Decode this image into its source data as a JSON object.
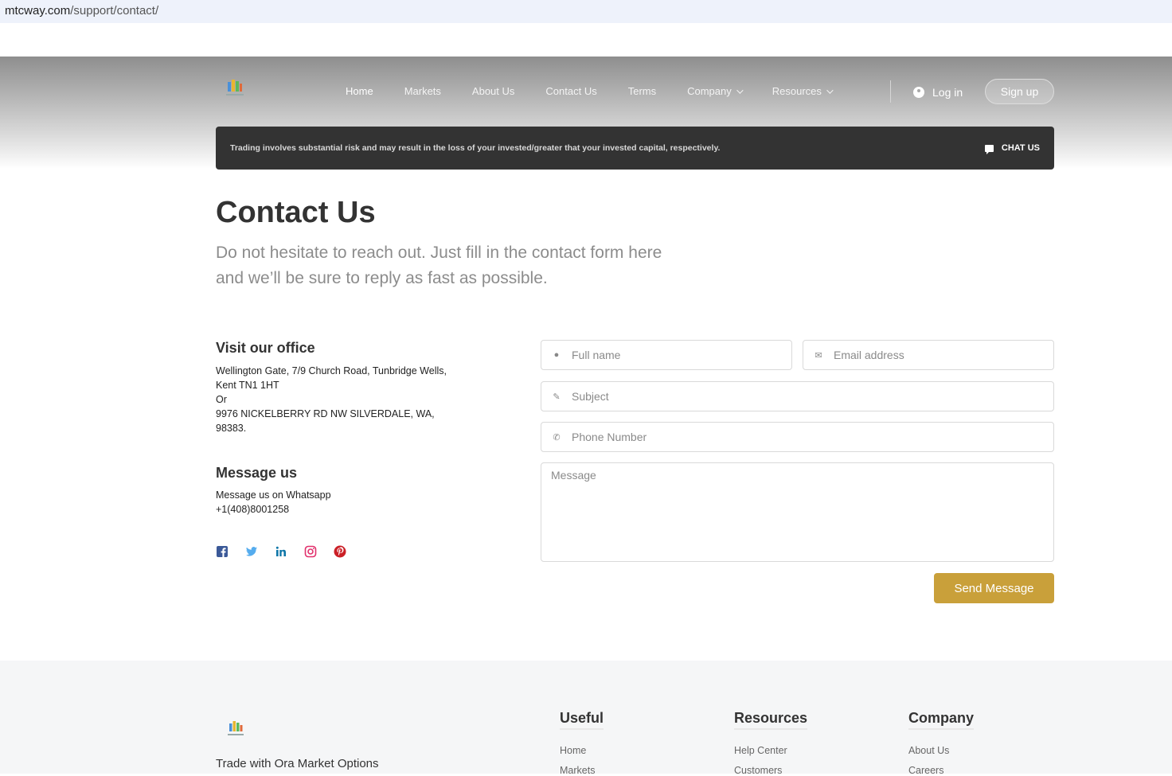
{
  "browser": {
    "domain": "mtcway.com",
    "path": "/support/contact/"
  },
  "nav": {
    "items": [
      {
        "label": "Home"
      },
      {
        "label": "Markets"
      },
      {
        "label": "About Us"
      },
      {
        "label": "Contact Us"
      },
      {
        "label": "Terms"
      },
      {
        "label": "Company"
      },
      {
        "label": "Resources"
      }
    ],
    "login": "Log in",
    "signup": "Sign up"
  },
  "risk_banner": {
    "text": "Trading involves substantial risk and may result in the loss of your invested/greater that your invested capital, respectively.",
    "chat": "CHAT US"
  },
  "page": {
    "title": "Contact Us",
    "lead_line1": "Do not hesitate to reach out. Just fill in the contact form here",
    "lead_line2": "and we’ll be sure to reply as fast as possible."
  },
  "office": {
    "heading": "Visit our office",
    "lines": [
      "Wellington Gate, 7/9 Church Road, Tunbridge Wells,",
      "Kent TN1 1HT",
      "Or",
      "9976 NICKELBERRY RD NW SILVERDALE, WA,",
      "98383."
    ]
  },
  "message": {
    "heading": "Message us",
    "lines": [
      "Message us on Whatsapp",
      "+1(408)8001258"
    ]
  },
  "socials": [
    {
      "icon": "facebook-icon",
      "color": "#3b5998"
    },
    {
      "icon": "twitter-icon",
      "color": "#55acee"
    },
    {
      "icon": "linkedin-icon",
      "color": "#0e76a8"
    },
    {
      "icon": "instagram-icon",
      "color": "#e1306c"
    },
    {
      "icon": "pinterest-icon",
      "color": "#cb2027"
    }
  ],
  "form": {
    "full_name_placeholder": "Full name",
    "email_placeholder": "Email address",
    "subject_placeholder": "Subject",
    "phone_placeholder": "Phone Number",
    "message_placeholder": "Message",
    "send_label": "Send Message"
  },
  "footer": {
    "tagline": "Trade with Ora Market Options",
    "columns": [
      {
        "heading": "Useful",
        "links": [
          "Home",
          "Markets"
        ]
      },
      {
        "heading": "Resources",
        "links": [
          "Help Center",
          "Customers"
        ]
      },
      {
        "heading": "Company",
        "links": [
          "About Us",
          "Careers"
        ]
      }
    ]
  },
  "colors": {
    "accent": "#c9a03a",
    "banner": "#333333"
  }
}
